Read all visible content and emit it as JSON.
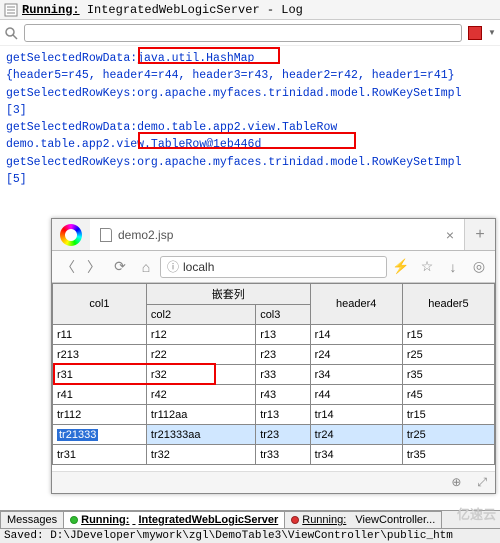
{
  "header": {
    "prefix": "Running:",
    "title": "IntegratedWebLogicServer - Log"
  },
  "log": {
    "l1a": "getSelectedRowData:",
    "l1b": "java.util.HashMap",
    "l2": "{header5=r45, header4=r44, header3=r43, header2=r42, header1=r41}",
    "l3": "getSelectedRowKeys:org.apache.myfaces.trinidad.model.RowKeySetImpl",
    "l4": "[3]",
    "l5a": "getSelectedRowData:",
    "l5b": "demo.table.app2.view.TableRow",
    "l6": "demo.table.app2.view.TableRow@1eb446d",
    "l7": "getSelectedRowKeys:org.apache.myfaces.trinidad.model.RowKeySetImpl",
    "l8": "[5]"
  },
  "browser": {
    "tab_title": "demo2.jsp",
    "url": "localh",
    "nested_header": "嵌套列",
    "cols": {
      "c1": "col1",
      "c2": "col2",
      "c3": "col3",
      "c4": "header4",
      "c5": "header5"
    },
    "rows": [
      {
        "c1": "r11",
        "c2": "r12",
        "c3": "r13",
        "c4": "r14",
        "c5": "r15"
      },
      {
        "c1": "r213",
        "c2": "r22",
        "c3": "r23",
        "c4": "r24",
        "c5": "r25"
      },
      {
        "c1": "r31",
        "c2": "r32",
        "c3": "r33",
        "c4": "r34",
        "c5": "r35"
      },
      {
        "c1": "r41",
        "c2": "r42",
        "c3": "r43",
        "c4": "r44",
        "c5": "r45"
      },
      {
        "c1": "tr112",
        "c2": "tr112aa",
        "c3": "tr13",
        "c4": "tr14",
        "c5": "tr15"
      },
      {
        "c1": "tr21333",
        "c2": "tr21333aa",
        "c3": "tr23",
        "c4": "tr24",
        "c5": "tr25"
      },
      {
        "c1": "tr31",
        "c2": "tr32",
        "c3": "tr33",
        "c4": "tr34",
        "c5": "tr35"
      }
    ]
  },
  "bottom_tabs": {
    "messages": "Messages",
    "run1a": "Running:",
    "run1b": "IntegratedWebLogicServer",
    "run2a": "Running:",
    "run2b": "ViewController..."
  },
  "status": "Saved: D:\\JDeveloper\\mywork\\zgl\\DemoTable3\\ViewController\\public_htm",
  "watermark": "亿速云"
}
